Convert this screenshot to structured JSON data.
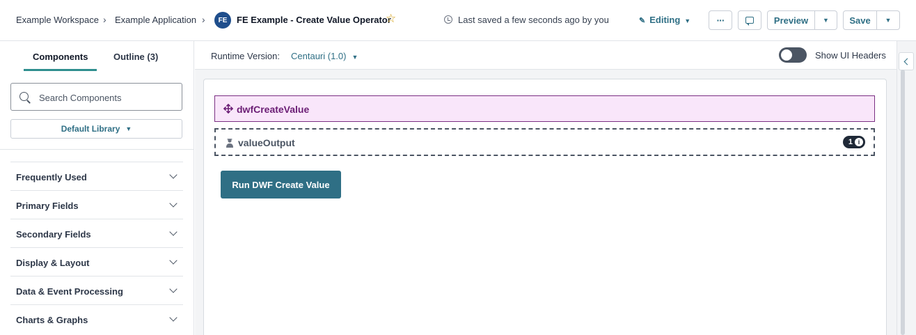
{
  "header": {
    "breadcrumb": [
      "Example Workspace",
      "Example Application"
    ],
    "app_badge": "FE",
    "app_title": "FE Example - Create Value Operator",
    "saved_status": "Last saved a few seconds ago by you",
    "editing_label": "Editing",
    "more_label": "···",
    "preview_label": "Preview",
    "save_label": "Save"
  },
  "left_panel": {
    "tabs": [
      {
        "label": "Components",
        "active": true
      },
      {
        "label": "Outline (3)",
        "active": false
      }
    ],
    "search": {
      "placeholder": "Search Components",
      "value": ""
    },
    "library_label": "Default Library",
    "categories": [
      "Frequently Used",
      "Primary Fields",
      "Secondary Fields",
      "Display & Layout",
      "Data & Event Processing",
      "Charts & Graphs"
    ]
  },
  "toolbar": {
    "runtime_label": "Runtime Version:",
    "runtime_value": "Centauri (1.0)",
    "show_headers_label": "Show UI Headers",
    "show_headers_on": false
  },
  "canvas": {
    "component1_label": "dwfCreateValue",
    "component2_label": "valueOutput",
    "component2_badge_count": "1",
    "info_glyph": "i",
    "run_button_label": "Run DWF Create Value"
  },
  "colors": {
    "accent": "#2f6f85",
    "component_highlight_bg": "#f9e6fa",
    "component_highlight_border": "#7a2f82",
    "badge_bg": "#1f4e8c"
  }
}
